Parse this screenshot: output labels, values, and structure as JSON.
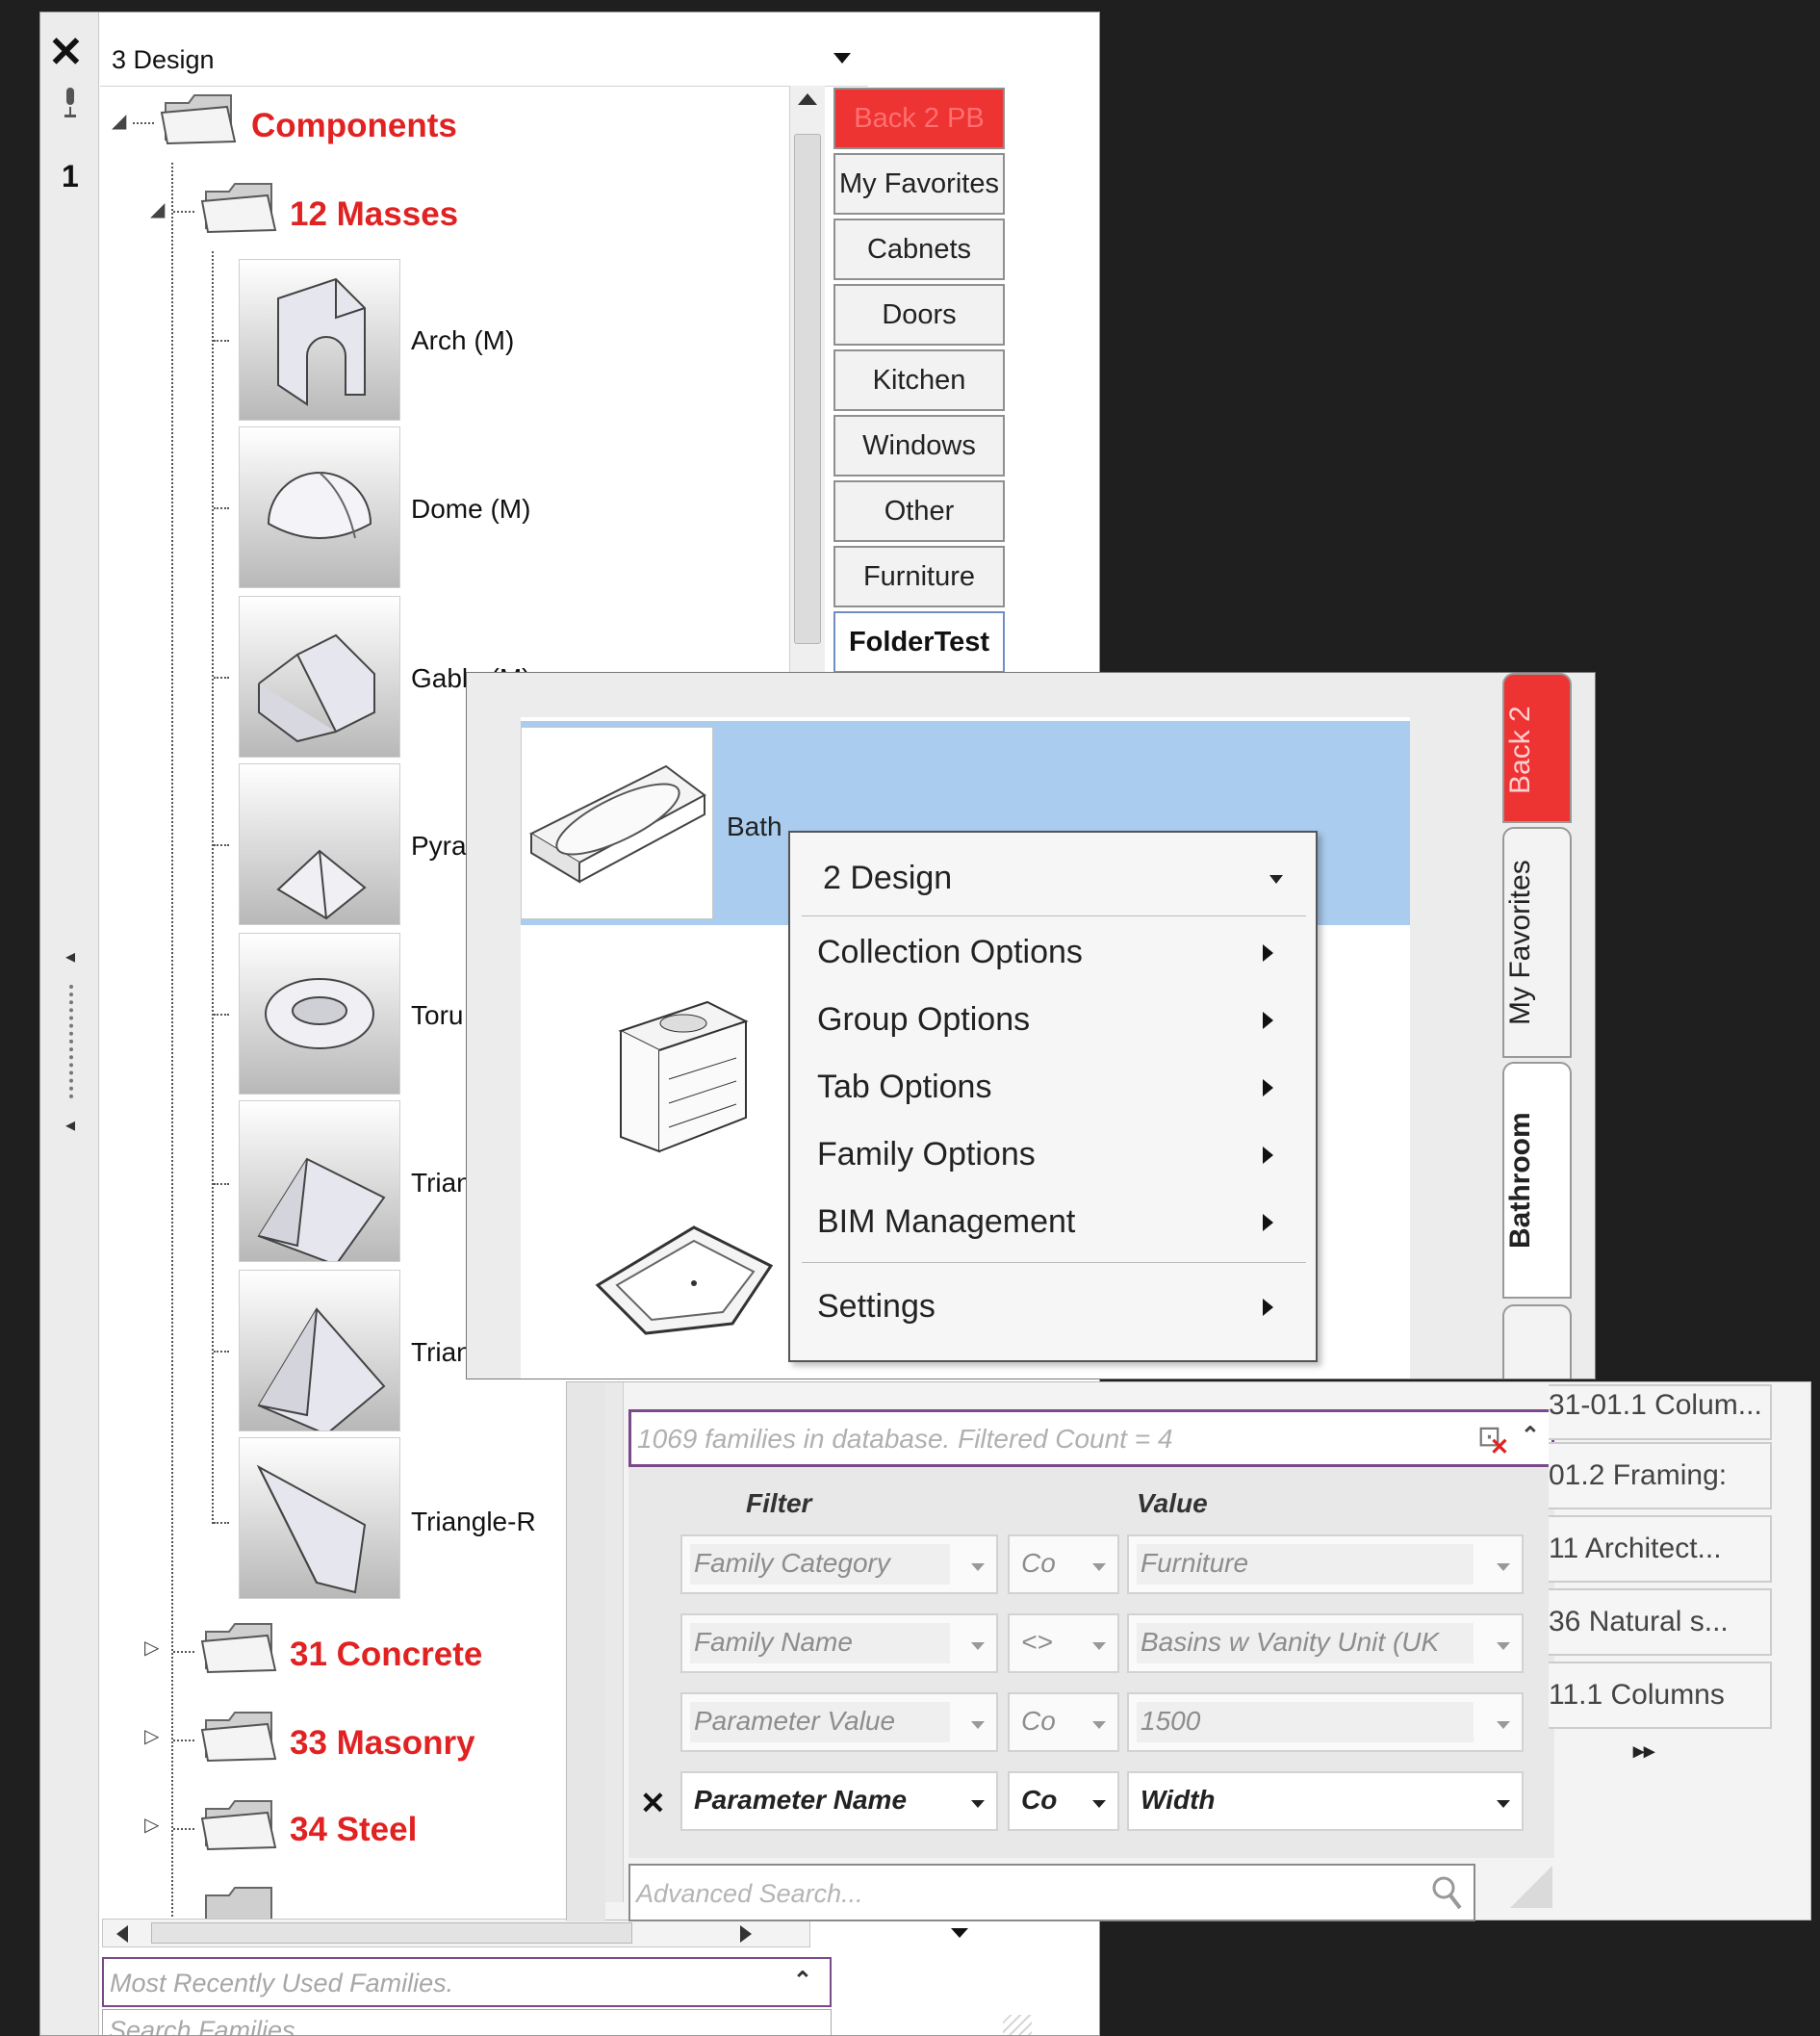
{
  "browser": {
    "close_label": "✕",
    "row_number": "1",
    "design_combo": "3 Design",
    "tree": {
      "root": "Components",
      "masses": "12 Masses",
      "items": [
        "Arch (M)",
        "Dome (M)",
        "Gable (M)",
        "Pyra",
        "Toru",
        "Trian",
        "Trian",
        "Triangle-R"
      ],
      "collapsed": [
        "31 Concrete",
        "33 Masonry",
        "34 Steel"
      ]
    },
    "tabs": [
      "Back 2 PB",
      "My Favorites",
      "Cabnets",
      "Doors",
      "Kitchen",
      "Windows",
      "Other",
      "Furniture",
      "FolderTest"
    ],
    "mru_placeholder": "Most Recently Used Families.",
    "search_placeholder": "Search Families..."
  },
  "context_panel": {
    "selected_item": "Bath",
    "vertical_tabs": [
      "Back 2",
      "My Favorites",
      "Bathroom"
    ],
    "menu": {
      "combo": "2 Design",
      "items": [
        "Collection Options",
        "Group Options",
        "Tab Options",
        "Family Options",
        "BIM Management"
      ],
      "settings": "Settings"
    }
  },
  "advanced_search": {
    "count_text": "1069 families in database.   Filtered Count = 4",
    "header_filter": "Filter",
    "header_value": "Value",
    "rows": [
      {
        "filter": "Family Category",
        "op": "Co",
        "value": "Furniture"
      },
      {
        "filter": "Family Name",
        "op": "<>",
        "value": "Basins w Vanity Unit (UK"
      },
      {
        "filter": "Parameter Value",
        "op": "Co",
        "value": "1500"
      },
      {
        "filter": "Parameter Name",
        "op": "Co",
        "value": "Width"
      }
    ],
    "advanced_placeholder": "Advanced Search...",
    "side_tabs": [
      "31-01.1 Colum...",
      "01.2 Framing:",
      "11 Architect...",
      "36 Natural s...",
      "11.1 Columns"
    ],
    "side_arrows": "▸▸"
  },
  "colors": {
    "accent_red": "#e02222",
    "tab_red": "#ee3333",
    "selection": "#aaccee",
    "focus_border": "#7a4a8a"
  }
}
